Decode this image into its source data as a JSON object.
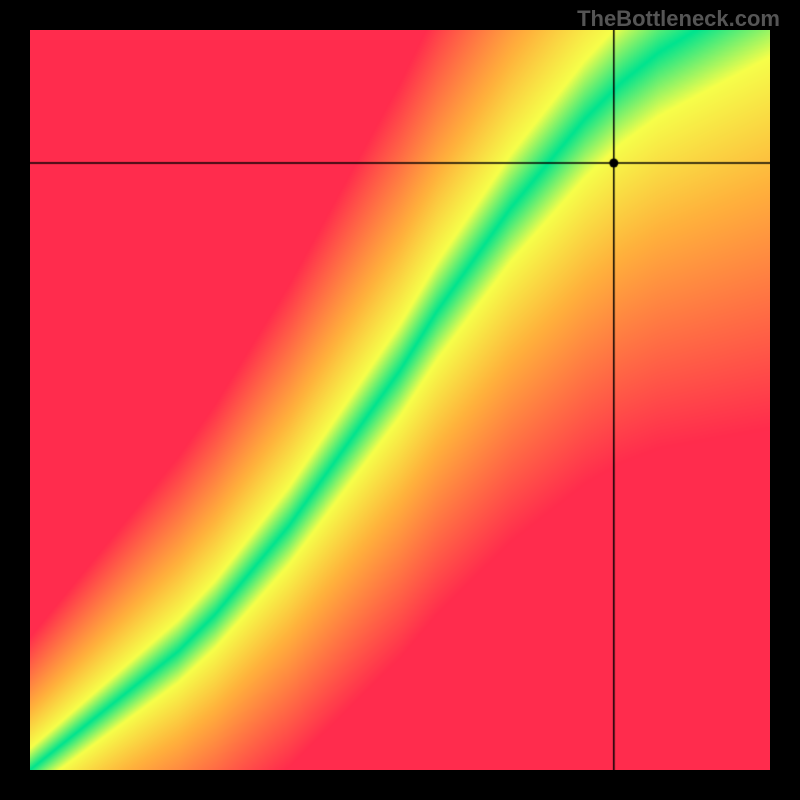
{
  "watermark": "TheBottleneck.com",
  "chart_data": {
    "type": "heatmap",
    "title": "",
    "xlabel": "",
    "ylabel": "",
    "xlim": [
      0,
      1
    ],
    "ylim": [
      0,
      1
    ],
    "marker": {
      "x": 0.79,
      "y": 0.82
    },
    "optimal_curve": [
      {
        "x": 0.0,
        "y": 0.0
      },
      {
        "x": 0.05,
        "y": 0.04
      },
      {
        "x": 0.1,
        "y": 0.08
      },
      {
        "x": 0.15,
        "y": 0.12
      },
      {
        "x": 0.2,
        "y": 0.16
      },
      {
        "x": 0.25,
        "y": 0.21
      },
      {
        "x": 0.3,
        "y": 0.27
      },
      {
        "x": 0.35,
        "y": 0.33
      },
      {
        "x": 0.4,
        "y": 0.4
      },
      {
        "x": 0.45,
        "y": 0.47
      },
      {
        "x": 0.5,
        "y": 0.54
      },
      {
        "x": 0.55,
        "y": 0.62
      },
      {
        "x": 0.6,
        "y": 0.69
      },
      {
        "x": 0.65,
        "y": 0.76
      },
      {
        "x": 0.7,
        "y": 0.82
      },
      {
        "x": 0.75,
        "y": 0.88
      },
      {
        "x": 0.8,
        "y": 0.93
      },
      {
        "x": 0.85,
        "y": 0.97
      },
      {
        "x": 0.9,
        "y": 1.0
      }
    ],
    "curve_thickness": 0.05,
    "color_stops": {
      "best": "#00e48f",
      "mid_hi": "#f6ff4a",
      "mid_lo": "#ffb23c",
      "worst": "#ff2c4d"
    }
  }
}
